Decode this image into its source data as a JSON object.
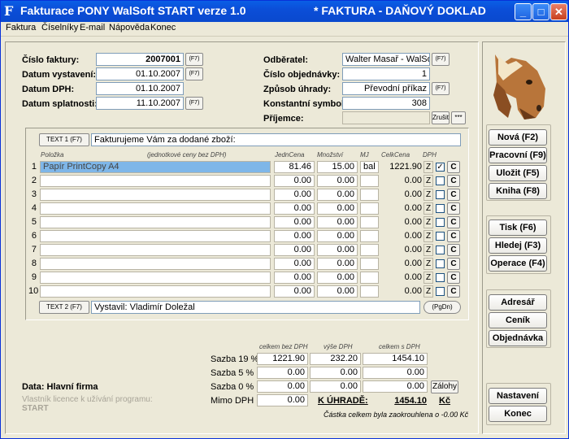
{
  "window": {
    "app_title": "Fakturace PONY WalSoft START verze 1.0",
    "doc_title": "*  FAKTURA - DAŇOVÝ DOKLAD",
    "icon_letter": "F"
  },
  "menu": [
    "Faktura",
    "Číselníky",
    "E-mail",
    "Nápověda",
    "Konec"
  ],
  "header": {
    "cislo_faktury": {
      "label": "Číslo faktury:",
      "value": "2007001",
      "btn": "(F7)"
    },
    "datum_vystaveni": {
      "label": "Datum vystavení:",
      "value": "01.10.2007",
      "btn": "(F7)"
    },
    "datum_dph": {
      "label": "Datum DPH:",
      "value": "01.10.2007"
    },
    "datum_splatnosti": {
      "label": "Datum splatnosti:",
      "value": "11.10.2007",
      "btn": "(F7)"
    },
    "odberatel": {
      "label": "Odběratel:",
      "value": "Walter Masař - WalSoft -",
      "btn": "(F7)"
    },
    "cislo_objednavky": {
      "label": "Číslo objednávky:",
      "value": "1"
    },
    "zpusob_uhrady": {
      "label": "Způsob úhrady:",
      "value": "Převodní příkaz",
      "btn": "(F7)"
    },
    "konst_symbol": {
      "label": "Konstantní symbol:",
      "value": "308"
    },
    "prijemce": {
      "label": "Příjemce:",
      "value": "",
      "zrusit": "Zrušit",
      "dots": "***"
    }
  },
  "text1": {
    "btn": "TEXT 1 (F7)",
    "value": "Fakturujeme Vám za dodané zboží:"
  },
  "text2": {
    "btn": "TEXT 2 (F7)",
    "value": "Vystavil: Vladimír Doležal",
    "pgdn": "(PgDn)"
  },
  "items_header": {
    "polozka": "Položka",
    "note": "(jednotkové ceny bez DPH)",
    "jedncena": "JednCena",
    "mnozstvi": "Množství",
    "mj": "MJ",
    "celkcena": "CelkCena",
    "dph": "DPH"
  },
  "items": [
    {
      "n": "1",
      "name": "Papír PrintCopy A4",
      "price": "81.46",
      "qty": "15.00",
      "mj": "bal",
      "total": "1221.90",
      "z": "Z",
      "checked": true,
      "c": "C"
    },
    {
      "n": "2",
      "name": "",
      "price": "0.00",
      "qty": "0.00",
      "mj": "",
      "total": "0.00",
      "z": "Z",
      "checked": false,
      "c": "C"
    },
    {
      "n": "3",
      "name": "",
      "price": "0.00",
      "qty": "0.00",
      "mj": "",
      "total": "0.00",
      "z": "Z",
      "checked": false,
      "c": "C"
    },
    {
      "n": "4",
      "name": "",
      "price": "0.00",
      "qty": "0.00",
      "mj": "",
      "total": "0.00",
      "z": "Z",
      "checked": false,
      "c": "C"
    },
    {
      "n": "5",
      "name": "",
      "price": "0.00",
      "qty": "0.00",
      "mj": "",
      "total": "0.00",
      "z": "Z",
      "checked": false,
      "c": "C"
    },
    {
      "n": "6",
      "name": "",
      "price": "0.00",
      "qty": "0.00",
      "mj": "",
      "total": "0.00",
      "z": "Z",
      "checked": false,
      "c": "C"
    },
    {
      "n": "7",
      "name": "",
      "price": "0.00",
      "qty": "0.00",
      "mj": "",
      "total": "0.00",
      "z": "Z",
      "checked": false,
      "c": "C"
    },
    {
      "n": "8",
      "name": "",
      "price": "0.00",
      "qty": "0.00",
      "mj": "",
      "total": "0.00",
      "z": "Z",
      "checked": false,
      "c": "C"
    },
    {
      "n": "9",
      "name": "",
      "price": "0.00",
      "qty": "0.00",
      "mj": "",
      "total": "0.00",
      "z": "Z",
      "checked": false,
      "c": "C"
    },
    {
      "n": "10",
      "name": "",
      "price": "0.00",
      "qty": "0.00",
      "mj": "",
      "total": "0.00",
      "z": "Z",
      "checked": false,
      "c": "C"
    }
  ],
  "summary": {
    "headers": [
      "celkem bez DPH",
      "výše DPH",
      "celkem s DPH"
    ],
    "rows": [
      {
        "label": "Sazba 19 %",
        "base": "1221.90",
        "vat": "232.20",
        "total": "1454.10"
      },
      {
        "label": "Sazba  5 %",
        "base": "0.00",
        "vat": "0.00",
        "total": "0.00"
      },
      {
        "label": "Sazba  0 %",
        "base": "0.00",
        "vat": "0.00",
        "total": "0.00"
      }
    ],
    "mimo_label": "Mimo DPH",
    "mimo_value": "0.00",
    "k_uhrade_label": "K ÚHRADĚ:",
    "k_uhrade_value": "1454.10",
    "currency": "Kč",
    "zalohy": "Zálohy",
    "note": "Částka celkem byla zaokrouhlena o -0.00 Kč"
  },
  "footer": {
    "data_label": "Data: Hlavní firma",
    "licence_label": "Vlastník licence k užívání programu:",
    "licence_value": "START"
  },
  "buttons": {
    "nova": "Nová (F2)",
    "pracovni": "Pracovní (F9)",
    "ulozit": "Uložit (F5)",
    "kniha": "Kniha (F8)",
    "tisk": "Tisk (F6)",
    "hledej": "Hledej (F3)",
    "operace": "Operace (F4)",
    "adresar": "Adresář",
    "cenik": "Ceník",
    "objednavka": "Objednávka",
    "nastaveni": "Nastavení",
    "konec": "Konec"
  }
}
